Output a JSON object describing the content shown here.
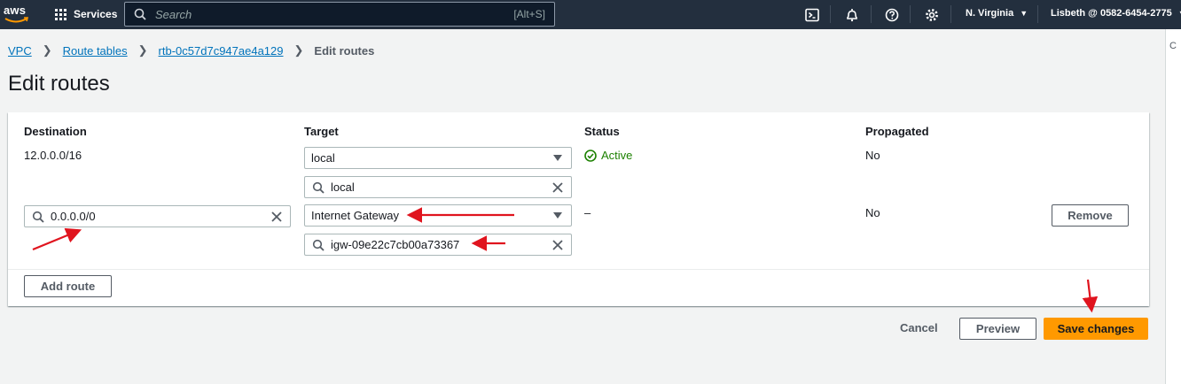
{
  "nav": {
    "logo": "aws",
    "services": "Services",
    "search_placeholder": "Search",
    "search_shortcut": "[Alt+S]",
    "region": "N. Virginia",
    "account": "Lisbeth @ 0582-6454-2775",
    "icons": [
      "cloudshell-icon",
      "notifications-icon",
      "help-icon",
      "settings-icon"
    ]
  },
  "rail": {
    "label": "C"
  },
  "breadcrumb": {
    "vpc": "VPC",
    "route_tables": "Route tables",
    "rtb": "rtb-0c57d7c947ae4a129",
    "current": "Edit routes"
  },
  "page": {
    "title": "Edit routes"
  },
  "table": {
    "headers": {
      "destination": "Destination",
      "target": "Target",
      "status": "Status",
      "propagated": "Propagated"
    },
    "rows": [
      {
        "destination": "12.0.0.0/16",
        "target": "local",
        "target_search": "local",
        "status": "Active",
        "propagated": "No"
      },
      {
        "destination": "0.0.0.0/0",
        "target": "Internet Gateway",
        "target_search": "igw-09e22c7cb00a73367",
        "status": "–",
        "propagated": "No",
        "remove": "Remove"
      }
    ],
    "add_route": "Add route"
  },
  "actions": {
    "cancel": "Cancel",
    "preview": "Preview",
    "save": "Save changes"
  },
  "colors": {
    "nav_bg": "#232f3e",
    "link": "#0073bb",
    "active": "#1d8102",
    "primary": "#ff9900",
    "annotation_arrow": "#e0141e"
  }
}
